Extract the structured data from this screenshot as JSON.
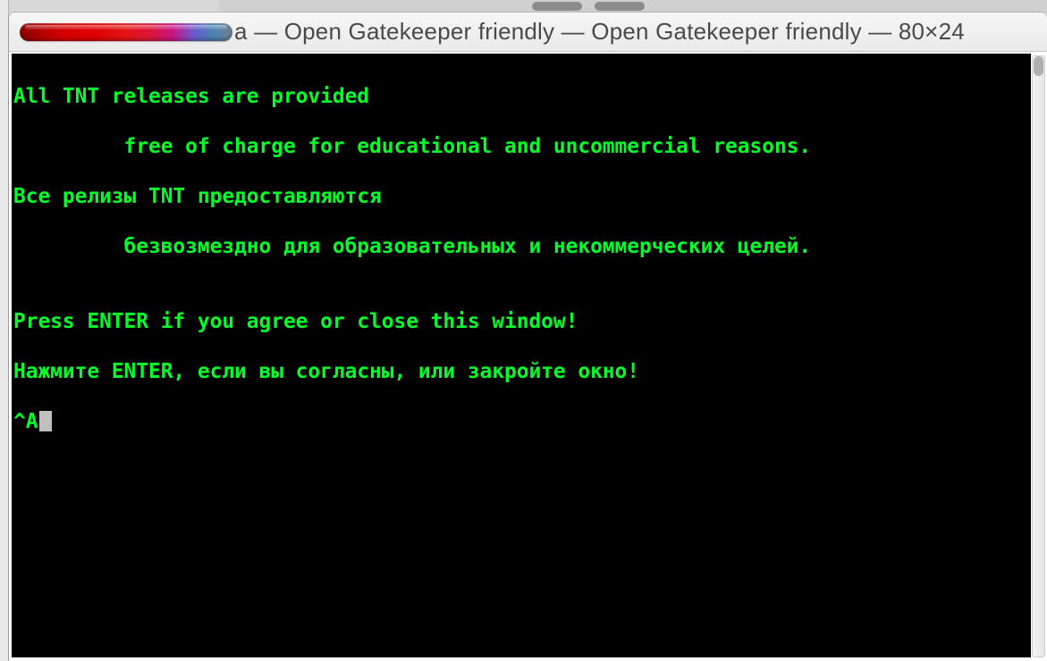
{
  "window": {
    "title": "a — Open Gatekeeper friendly — Open Gatekeeper friendly — 80×24"
  },
  "terminal": {
    "lines": [
      "All TNT releases are provided",
      "         free of charge for educational and uncommercial reasons.",
      "Все релизы TNT предоставляются",
      "         безвозмездно для образовательных и некоммерческих целей.",
      "",
      "Press ENTER if you agree or close this window!",
      "Нажмите ENTER, если вы согласны, или закройте окно!"
    ],
    "prompt": "^A"
  }
}
